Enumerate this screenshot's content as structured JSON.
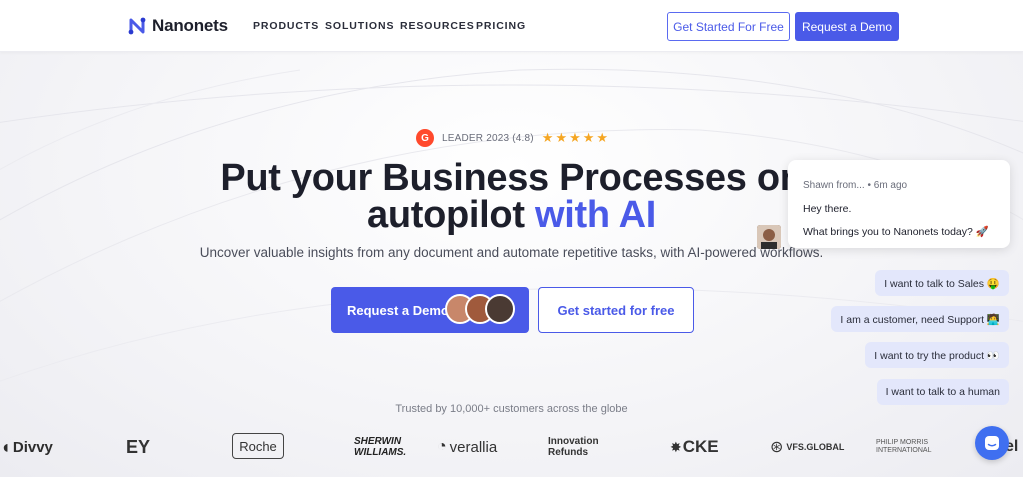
{
  "nav": {
    "logo_text": "Nanonets",
    "links": [
      "PRODUCTS",
      "SOLUTIONS",
      "RESOURCES",
      "PRICING"
    ],
    "get_started": "Get Started For Free",
    "request_demo": "Request a Demo"
  },
  "hero": {
    "badge_text": "LEADER 2023 (4.8)",
    "badge_icon": "g2-icon",
    "rating_stars": 5,
    "title_line1": "Put your Business Processes on",
    "title_line2_plain": "autopilot",
    "title_line2_accent": "with AI",
    "subtitle": "Uncover valuable insights from any document and automate repetitive tasks, with AI-powered workflows.",
    "demo_button": "Request a Demo",
    "free_button": "Get started for free"
  },
  "trusted": {
    "text": "Trusted by 10,000+ customers across the globe",
    "brands": [
      "Divvy",
      "EY",
      "Roche",
      "SHERWIN WILLIAMS.",
      "verallia",
      "Innovation Refunds",
      "CKE",
      "VFS.GLOBAL",
      "PHILIP MORRIS INTERNATIONAL",
      "el"
    ]
  },
  "chat": {
    "sender": "Shawn from...",
    "time": "• 6m ago",
    "line1": "Hey there.",
    "line2": "What brings you to Nanonets today? 🚀",
    "quick_replies": [
      "I want to talk to Sales 🤑",
      "I am a customer, need Support 🧑‍💻",
      "I want to try the product 👀",
      "I want to talk to a human"
    ]
  },
  "colors": {
    "accent": "#4a5ae8",
    "text": "#1d1f2b",
    "chat_chip": "#e3e7fb",
    "launcher": "#3f6ff0",
    "g2": "#ff492c",
    "star": "#f5a623"
  }
}
